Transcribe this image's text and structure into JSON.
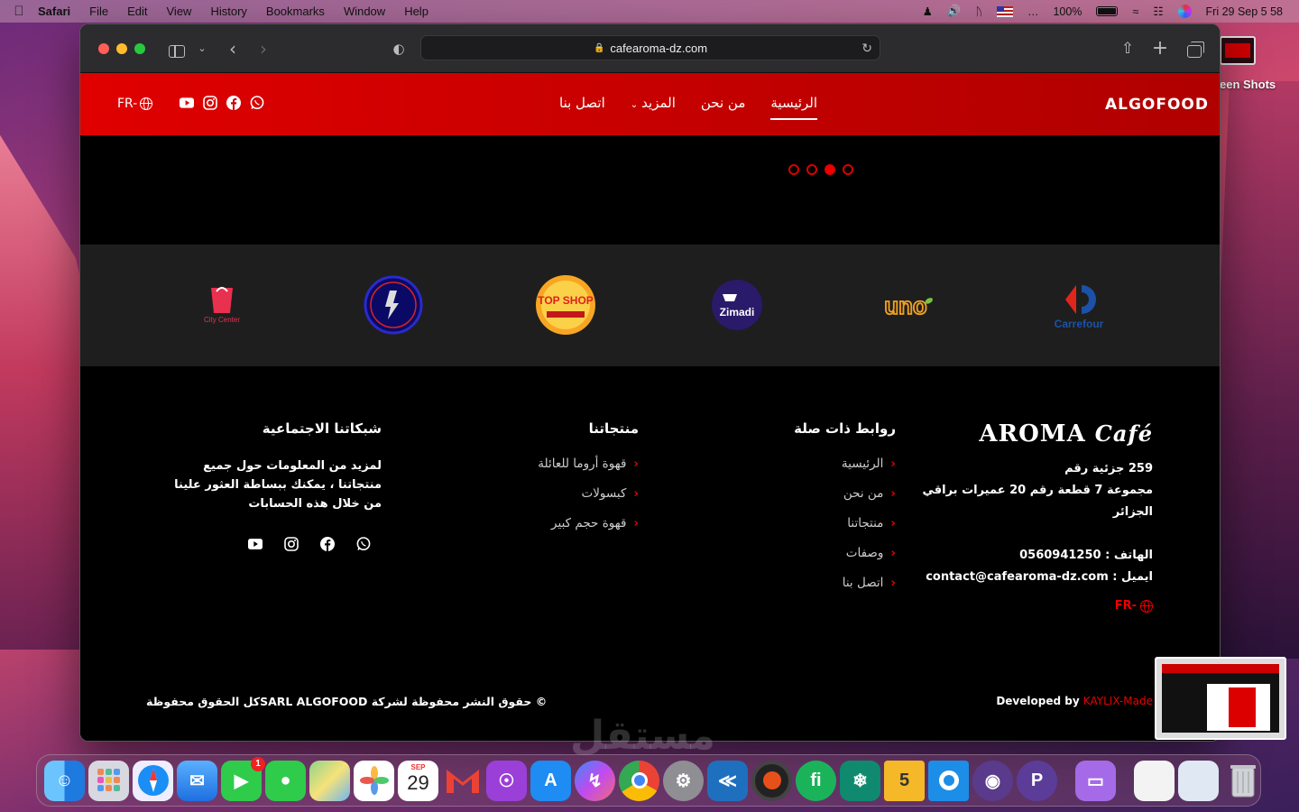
{
  "menubar": {
    "app": "Safari",
    "items": [
      "File",
      "Edit",
      "View",
      "History",
      "Bookmarks",
      "Window",
      "Help"
    ],
    "battery": "100%",
    "datetime": "Fri 29 Sep  5 58"
  },
  "desktop": {
    "folder_label": "een Shots"
  },
  "browser": {
    "url": "cafearoma-dz.com"
  },
  "site": {
    "brand": "ALGOFOOD",
    "nav": {
      "home": "الرئيسية",
      "about": "من نحن",
      "more": "المزيد",
      "contact": "اتصل بنا"
    },
    "lang": "FR-",
    "slider_dots": 4,
    "slider_active_index": 2
  },
  "partners": [
    "City Center",
    "",
    "TOP SHOP",
    "Zimadi",
    "uno",
    "Carrefour"
  ],
  "footer": {
    "aroma_logo_main": "AROMA",
    "aroma_logo_script": "Café",
    "address_line1": "259 جزئية رقم",
    "address_line2": "مجموعة 7 قطعة رقم 20 عميرات براقي",
    "address_line3": "الجزائر",
    "phone": "الهاتف : 0560941250",
    "email": "ايميل : contact@cafearoma-dz.com",
    "lang": "FR-",
    "links_title": "روابط ذات صلة",
    "links": [
      "الرئيسية",
      "من نحن",
      "منتجاتنا",
      "وصفات",
      "اتصل بنا"
    ],
    "products_title": "منتجاتنا",
    "products": [
      "قهوة أروما للعائلة",
      "كبسولات",
      "قهوة حجم كبير"
    ],
    "social_title": "شبكاتنا الاجتماعية",
    "social_text": "لمزيد من المعلومات حول جميع منتجاتنا ، يمكنك ببساطة العثور علينا من خلال هذه الحسابات",
    "copyright": "© حقوق النشر محفوظة لشركة SARL ALGOFOODكل الحقوق محفوظة",
    "developed_by": "Developed by ",
    "developer": "KAYLIX-Made"
  },
  "watermark": "مستقل",
  "dock": {
    "calendar_month": "SEP",
    "calendar_day": "29",
    "facetime_badge": "1"
  },
  "colors": {
    "brand_red": "#e00000",
    "footer_bg": "#000000",
    "partners_bg": "#1e1e1e"
  }
}
